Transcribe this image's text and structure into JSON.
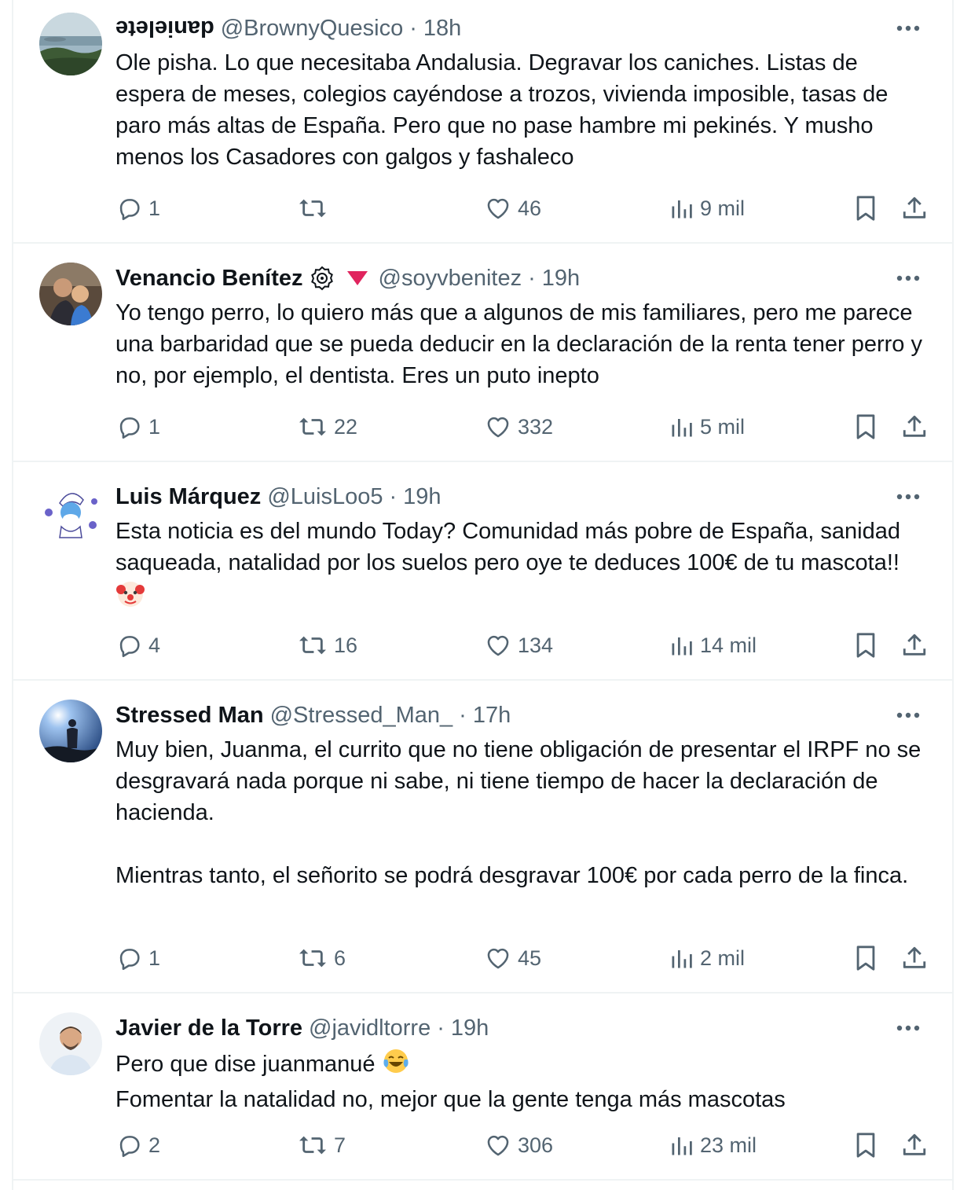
{
  "tweets": [
    {
      "name": "danielete",
      "handle": "@BrownyQuesico",
      "sep": "·",
      "time": "18h",
      "lines": [
        "Ole pisha. Lo que necesitaba Andalusia. Degravar los caniches. Listas de espera de meses, colegios cayéndose a trozos, vivienda imposible, tasas de paro más altas de España. Pero que no pase hambre mi pekinés. Y musho menos los Casadores con galgos y fashaleco"
      ],
      "replies": "1",
      "retweets": "",
      "likes": "46",
      "views": "9 mil"
    },
    {
      "name": "Venancio Benítez",
      "handle": "@soyvbenitez",
      "sep": "·",
      "time": "19h",
      "lines": [
        "Yo tengo perro, lo quiero más que a algunos de mis familiares, pero me parece una barbaridad que se pueda deducir en la declaración de la renta tener perro y no, por ejemplo, el dentista. Eres un puto inepto"
      ],
      "replies": "1",
      "retweets": "22",
      "likes": "332",
      "views": "5 mil"
    },
    {
      "name": "Luis Márquez",
      "handle": "@LuisLoo5",
      "sep": "·",
      "time": "19h",
      "lines": [
        "Esta noticia es del mundo Today? Comunidad más pobre de España, sanidad saqueada, natalidad por los suelos pero oye te deduces 100€ de tu mascota!!"
      ],
      "replies": "4",
      "retweets": "16",
      "likes": "134",
      "views": "14 mil"
    },
    {
      "name": "Stressed Man",
      "handle": "@Stressed_Man_",
      "sep": "·",
      "time": "17h",
      "lines": [
        "Muy bien, Juanma, el currito que no tiene obligación de presentar el IRPF no se desgravará nada porque ni sabe, ni tiene tiempo de hacer la declaración de hacienda.",
        "Mientras tanto, el señorito se podrá desgravar 100€ por cada perro de la finca."
      ],
      "replies": "1",
      "retweets": "6",
      "likes": "45",
      "views": "2 mil"
    },
    {
      "name": "Javier de la Torre",
      "handle": "@javidltorre",
      "sep": "·",
      "time": "19h",
      "lines": [
        "Pero que dise juanmanué",
        "Fomentar la natalidad no, mejor que la gente tenga más mascotas"
      ],
      "replies": "2",
      "retweets": "7",
      "likes": "306",
      "views": "23 mil"
    }
  ],
  "icons": {
    "reply": "reply-icon",
    "retweet": "retweet-icon",
    "like": "heart-icon",
    "views": "views-icon",
    "bookmark": "bookmark-icon",
    "share": "share-icon",
    "more": "more-icon",
    "verified": "verified-badge-icon",
    "flag": "red-triangle-icon",
    "clown": "clown-face-emoji",
    "laugh": "tears-of-joy-emoji"
  },
  "colors": {
    "text": "#0f1419",
    "secondary": "#536471",
    "divider": "#eff3f4",
    "triangle": "#e0245e"
  }
}
